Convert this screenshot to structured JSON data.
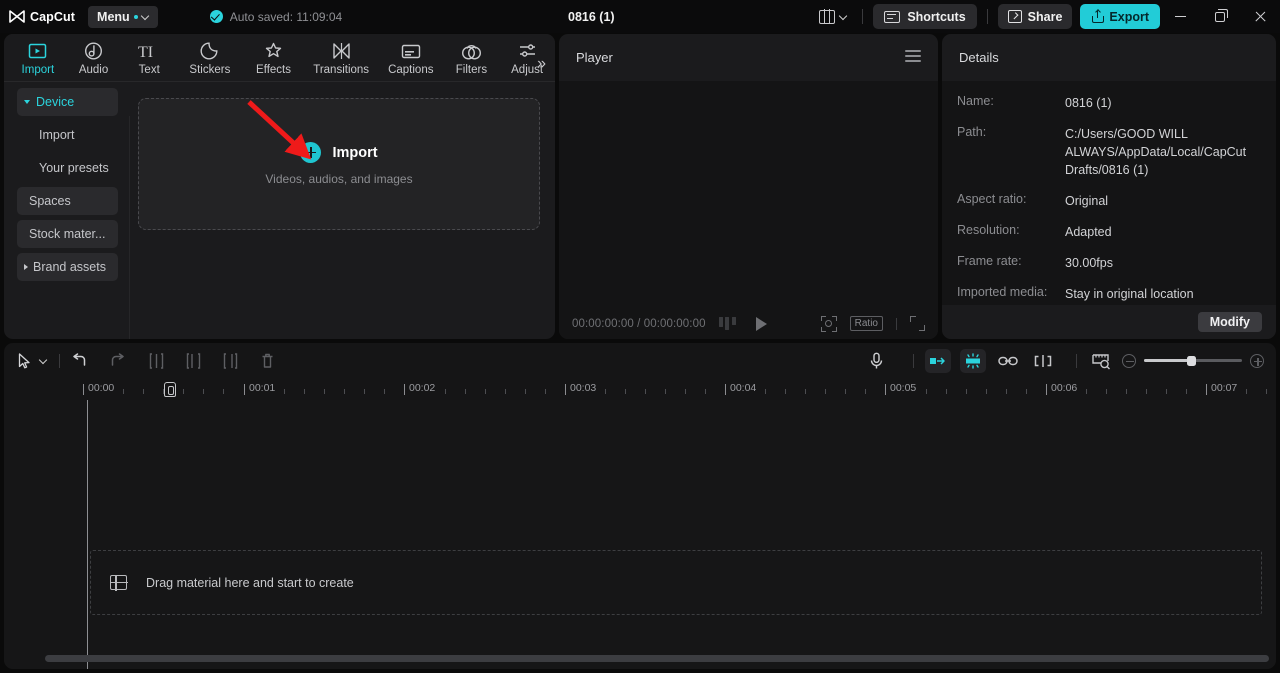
{
  "app": {
    "name": "CapCut"
  },
  "titlebar": {
    "menu_label": "Menu",
    "autosave_text": "Auto saved: 11:09:04",
    "project_title": "0816 (1)",
    "shortcuts_label": "Shortcuts",
    "share_label": "Share",
    "export_label": "Export",
    "accent": "#22ccd7"
  },
  "tooltabs": [
    {
      "label": "Import",
      "icon": "import-icon",
      "active": true
    },
    {
      "label": "Audio",
      "icon": "audio-icon",
      "active": false
    },
    {
      "label": "Text",
      "icon": "text-icon",
      "active": false
    },
    {
      "label": "Stickers",
      "icon": "stickers-icon",
      "active": false
    },
    {
      "label": "Effects",
      "icon": "effects-icon",
      "active": false
    },
    {
      "label": "Transitions",
      "icon": "transitions-icon",
      "active": false
    },
    {
      "label": "Captions",
      "icon": "captions-icon",
      "active": false
    },
    {
      "label": "Filters",
      "icon": "filters-icon",
      "active": false
    },
    {
      "label": "Adjust",
      "icon": "adjust-icon",
      "active": false
    }
  ],
  "tooltabs_more": "»",
  "sidebar": {
    "items": [
      {
        "label": "Device",
        "selected": true,
        "expanded": true
      },
      {
        "label": "Import",
        "selected": false,
        "expanded": false
      },
      {
        "label": "Your presets",
        "selected": false,
        "expanded": false
      },
      {
        "label": "Spaces",
        "selected": true,
        "expanded": false
      },
      {
        "label": "Stock mater...",
        "selected": true,
        "expanded": false
      },
      {
        "label": "Brand assets",
        "selected": true,
        "expanded": false
      }
    ]
  },
  "import_drop": {
    "label": "Import",
    "sub": "Videos, audios, and images"
  },
  "player": {
    "title": "Player",
    "current_time": "00:00:00:00",
    "total_time": "00:00:00:00",
    "timecode": "00:00:00:00 / 00:00:00:00",
    "ratio_label": "Ratio"
  },
  "details": {
    "title": "Details",
    "rows": [
      {
        "label": "Name:",
        "value": "0816 (1)"
      },
      {
        "label": "Path:",
        "value": "C:/Users/GOOD WILL ALWAYS/AppData/Local/CapCut Drafts/0816 (1)"
      },
      {
        "label": "Aspect ratio:",
        "value": "Original"
      },
      {
        "label": "Resolution:",
        "value": "Adapted"
      },
      {
        "label": "Frame rate:",
        "value": "30.00fps"
      },
      {
        "label": "Imported media:",
        "value": "Stay in original location"
      }
    ],
    "modify_label": "Modify"
  },
  "timeline": {
    "ruler_labels": [
      "00:00",
      "00:01",
      "00:02",
      "00:03",
      "00:04",
      "00:05",
      "00:06",
      "00:07"
    ],
    "dropzone_text": "Drag material here and start to create",
    "playhead_time": "00:00",
    "zoom_percent": 45
  }
}
